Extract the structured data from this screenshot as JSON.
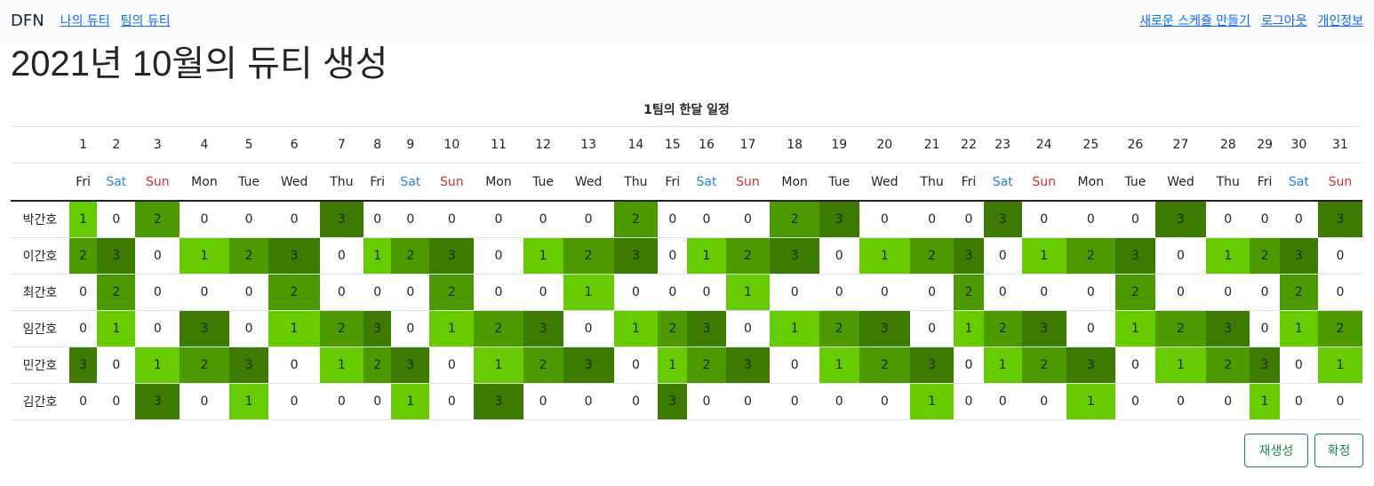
{
  "nav": {
    "brand": "DFN",
    "my_duty": "나의 듀티",
    "team_duty": "팀의 듀티",
    "new_schedule": "새로운 스케쥴 만들기",
    "logout": "로그아웃",
    "profile": "개인정보"
  },
  "page_title": "2021년 10월의 듀티 생성",
  "table_caption": "1팀의 한달 일정",
  "days": [
    "1",
    "2",
    "3",
    "4",
    "5",
    "6",
    "7",
    "8",
    "9",
    "10",
    "11",
    "12",
    "13",
    "14",
    "15",
    "16",
    "17",
    "18",
    "19",
    "20",
    "21",
    "22",
    "23",
    "24",
    "25",
    "26",
    "27",
    "28",
    "29",
    "30",
    "31"
  ],
  "weekdays": [
    "Fri",
    "Sat",
    "Sun",
    "Mon",
    "Tue",
    "Wed",
    "Thu",
    "Fri",
    "Sat",
    "Sun",
    "Mon",
    "Tue",
    "Wed",
    "Thu",
    "Fri",
    "Sat",
    "Sun",
    "Mon",
    "Tue",
    "Wed",
    "Thu",
    "Fri",
    "Sat",
    "Sun",
    "Mon",
    "Tue",
    "Wed",
    "Thu",
    "Fri",
    "Sat",
    "Sun"
  ],
  "nurses": [
    {
      "name": "박간호",
      "duties": [
        1,
        0,
        2,
        0,
        0,
        0,
        3,
        0,
        0,
        0,
        0,
        0,
        0,
        2,
        0,
        0,
        0,
        2,
        3,
        0,
        0,
        0,
        3,
        0,
        0,
        0,
        3,
        0,
        0,
        0,
        3
      ]
    },
    {
      "name": "이간호",
      "duties": [
        2,
        3,
        0,
        1,
        2,
        3,
        0,
        1,
        2,
        3,
        0,
        1,
        2,
        3,
        0,
        1,
        2,
        3,
        0,
        1,
        2,
        3,
        0,
        1,
        2,
        3,
        0,
        1,
        2,
        3,
        0
      ]
    },
    {
      "name": "최간호",
      "duties": [
        0,
        2,
        0,
        0,
        0,
        2,
        0,
        0,
        0,
        2,
        0,
        0,
        1,
        0,
        0,
        0,
        1,
        0,
        0,
        0,
        0,
        2,
        0,
        0,
        0,
        2,
        0,
        0,
        0,
        2,
        0
      ]
    },
    {
      "name": "임간호",
      "duties": [
        0,
        1,
        0,
        3,
        0,
        1,
        2,
        3,
        0,
        1,
        2,
        3,
        0,
        1,
        2,
        3,
        0,
        1,
        2,
        3,
        0,
        1,
        2,
        3,
        0,
        1,
        2,
        3,
        0,
        1,
        2
      ]
    },
    {
      "name": "민간호",
      "duties": [
        3,
        0,
        1,
        2,
        3,
        0,
        1,
        2,
        3,
        0,
        1,
        2,
        3,
        0,
        1,
        2,
        3,
        0,
        1,
        2,
        3,
        0,
        1,
        2,
        3,
        0,
        1,
        2,
        3,
        0,
        1
      ]
    },
    {
      "name": "김간호",
      "duties": [
        0,
        0,
        3,
        0,
        1,
        0,
        0,
        0,
        1,
        0,
        3,
        0,
        0,
        0,
        3,
        0,
        0,
        0,
        0,
        0,
        1,
        0,
        0,
        0,
        1,
        0,
        0,
        0,
        1,
        0,
        0
      ]
    }
  ],
  "colors": {
    "duty_0": "#ffffff",
    "duty_1": "#66cc00",
    "duty_2": "#4d9900",
    "duty_3": "#3d7a00",
    "saturday": "#1e88e5",
    "sunday": "#d32f2f",
    "link": "#0d6efd",
    "button": "#198754"
  },
  "buttons": {
    "regenerate": "재생성",
    "confirm": "확정"
  }
}
